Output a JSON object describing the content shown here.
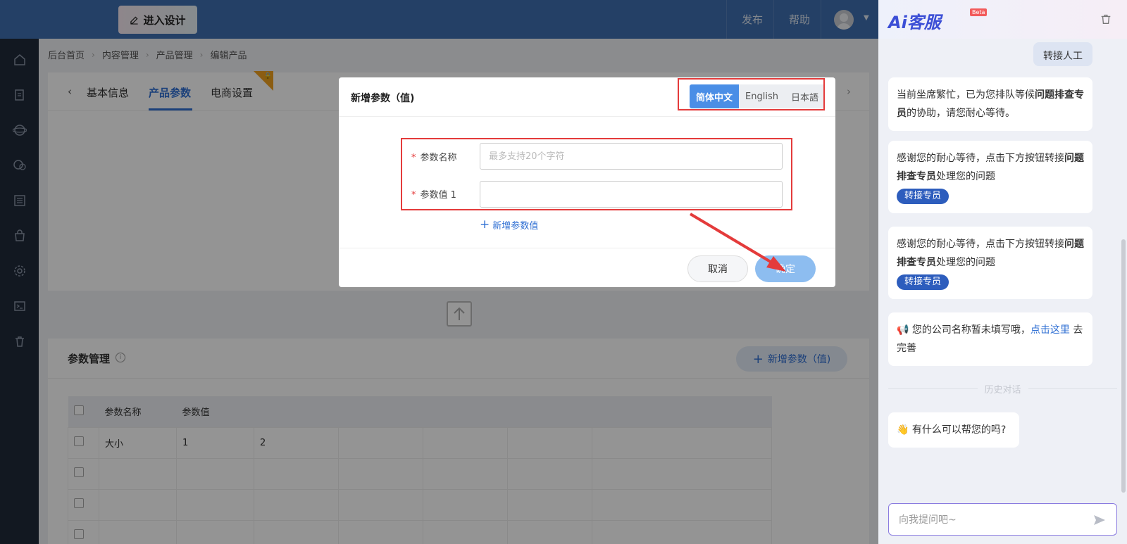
{
  "topbar": {
    "design_label": "进入设计",
    "nav": [
      "发布",
      "帮助"
    ]
  },
  "breadcrumb": [
    "后台首页",
    "内容管理",
    "产品管理",
    "编辑产品"
  ],
  "tabs": [
    "基本信息",
    "产品参数",
    "电商设置"
  ],
  "param_section": {
    "title": "参数管理",
    "add_button": "新增参数（值)",
    "columns": [
      "参数名称",
      "参数值"
    ],
    "rows": [
      {
        "name": "大小",
        "values": [
          "1",
          "2"
        ]
      }
    ]
  },
  "modal": {
    "title": "新增参数（值)",
    "languages": [
      {
        "label": "简体中文",
        "active": true
      },
      {
        "label": "English",
        "active": false
      },
      {
        "label": "日本語",
        "active": false
      }
    ],
    "fields": [
      {
        "label": "参数名称",
        "placeholder": "最多支持20个字符",
        "value": ""
      },
      {
        "label": "参数值 1",
        "placeholder": "",
        "value": ""
      }
    ],
    "add_value": "新增参数值",
    "cancel": "取消",
    "ok": "确定"
  },
  "ai": {
    "logo": "Ai客服",
    "beta": "Beta",
    "partial_reply": "转接人工",
    "messages": [
      {
        "pre": "当前坐席繁忙，已为您排队等候",
        "bold": "问题排查专员",
        "post": "的协助，请您耐心等待。"
      },
      {
        "pre": "感谢您的耐心等待，点击下方按钮转接",
        "bold": "问题排查专员",
        "post": "处理您的问题",
        "chip": "转接专员"
      },
      {
        "pre": "感谢您的耐心等待，点击下方按钮转接",
        "bold": "问题排查专员",
        "post": "处理您的问题",
        "chip": "转接专员"
      },
      {
        "emoji": "📢",
        "pre": "您的公司名称暂未填写哦，",
        "link": "点击这里",
        "post": "去完善"
      },
      {
        "emoji": "👋",
        "pre": "有什么可以帮您的吗?"
      }
    ],
    "history": "历史对话",
    "input_placeholder": "向我提问吧~"
  },
  "colors": {
    "topbar": "#3f6fb0",
    "primary": "#2f6fd3",
    "annotation_red": "#e43b3b"
  }
}
